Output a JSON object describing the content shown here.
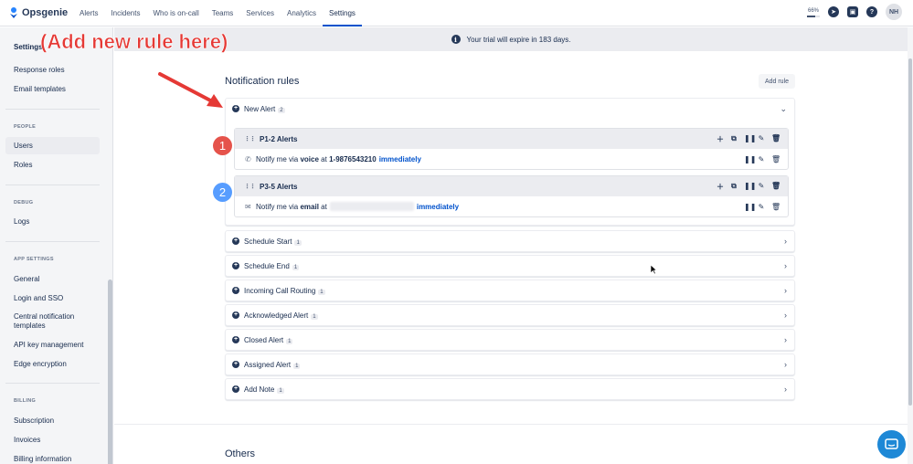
{
  "app": {
    "name": "Opsgenie"
  },
  "nav": [
    {
      "label": "Alerts",
      "active": false
    },
    {
      "label": "Incidents",
      "active": false
    },
    {
      "label": "Who is on-call",
      "active": false
    },
    {
      "label": "Teams",
      "active": false
    },
    {
      "label": "Services",
      "active": false
    },
    {
      "label": "Analytics",
      "active": false
    },
    {
      "label": "Settings",
      "active": true
    }
  ],
  "topbar": {
    "zoom": "66%",
    "avatar_initials": "NH"
  },
  "sidebar": {
    "settings": "Settings",
    "response_roles": "Response roles",
    "email_templates": "Email templates",
    "people_heading": "PEOPLE",
    "users": "Users",
    "roles": "Roles",
    "debug_heading": "DEBUG",
    "logs": "Logs",
    "app_settings_heading": "APP SETTINGS",
    "general": "General",
    "login_sso": "Login and SSO",
    "central_notification_1": "Central notification",
    "central_notification_2": "templates",
    "api_key": "API key management",
    "edge_encryption": "Edge encryption",
    "billing_heading": "BILLING",
    "subscription": "Subscription",
    "invoices": "Invoices",
    "billing_info": "Billing information"
  },
  "banner": {
    "text": "Your trial will expire in 183 days."
  },
  "annotation": {
    "text": "(Add new rule here)",
    "color": "#e53935"
  },
  "notification_rules": {
    "title": "Notification rules",
    "add_button": "Add rule",
    "expanded": {
      "label": "New Alert",
      "count": "2",
      "groups": [
        {
          "marker": "1",
          "name": "P1-2 Alerts",
          "line": {
            "prefix": "Notify me via",
            "method": "voice",
            "at": "at",
            "target": "1-9876543210",
            "timing": "immediately"
          }
        },
        {
          "marker": "2",
          "name": "P3-5 Alerts",
          "line": {
            "prefix": "Notify me via",
            "method": "email",
            "at": "at",
            "target": "",
            "timing": "immediately"
          }
        }
      ]
    },
    "rules": [
      {
        "label": "Schedule Start",
        "count": "1"
      },
      {
        "label": "Schedule End",
        "count": "1"
      },
      {
        "label": "Incoming Call Routing",
        "count": "1"
      },
      {
        "label": "Acknowledged Alert",
        "count": "1"
      },
      {
        "label": "Closed Alert",
        "count": "1"
      },
      {
        "label": "Assigned Alert",
        "count": "1"
      },
      {
        "label": "Add Note",
        "count": "1"
      }
    ]
  },
  "others": {
    "title": "Others"
  },
  "colors": {
    "accent": "#0052cc",
    "marker_red": "#e5534b",
    "marker_blue": "#579dff",
    "chat": "#1e88d6"
  }
}
